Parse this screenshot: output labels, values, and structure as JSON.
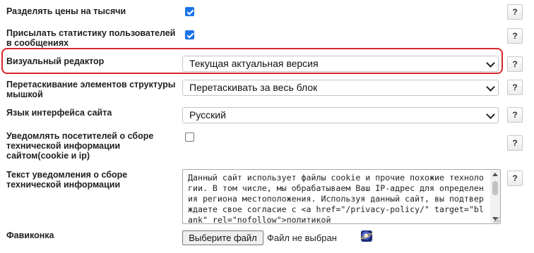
{
  "settings": {
    "thousands": {
      "label": "Разделять цены на тысячи",
      "checked": true,
      "help": "?"
    },
    "stats": {
      "label": "Присылать статистику пользователей в сообщениях",
      "checked": true,
      "help": "?"
    },
    "visual_editor": {
      "label": "Визуальный редактор",
      "value": "Текущая актуальная версия",
      "help": "?"
    },
    "drag": {
      "label": "Перетаскивание элементов структуры мышкой",
      "value": "Перетаскивать за весь блок",
      "help": "?"
    },
    "language": {
      "label": "Язык интерфейса сайта",
      "value": "Русский",
      "help": "?"
    },
    "notify": {
      "label": "Уведомлять посетителей о сборе технической информации сайтом(cookie и ip)",
      "checked": false,
      "help": "?"
    },
    "notice_text": {
      "label": "Текст уведомления о сборе технической информации",
      "value": "Данный сайт использует файлы cookie и прочие похожие технологии. В том числе, мы обрабатываем Ваш IP-адрес для определения региона местоположения. Используя данный сайт, вы подтверждаете свое согласие с <a href=\"/privacy-policy/\" target=\"blank\" rel=\"nofollow\">политикой",
      "help": "?"
    },
    "favicon": {
      "label": "Фавиконка",
      "button": "Выберите файл",
      "status": "Файл не выбран",
      "icon": "planet-icon"
    }
  },
  "colors": {
    "highlight": "#d6262c",
    "checkbox": "#1a73e8"
  }
}
